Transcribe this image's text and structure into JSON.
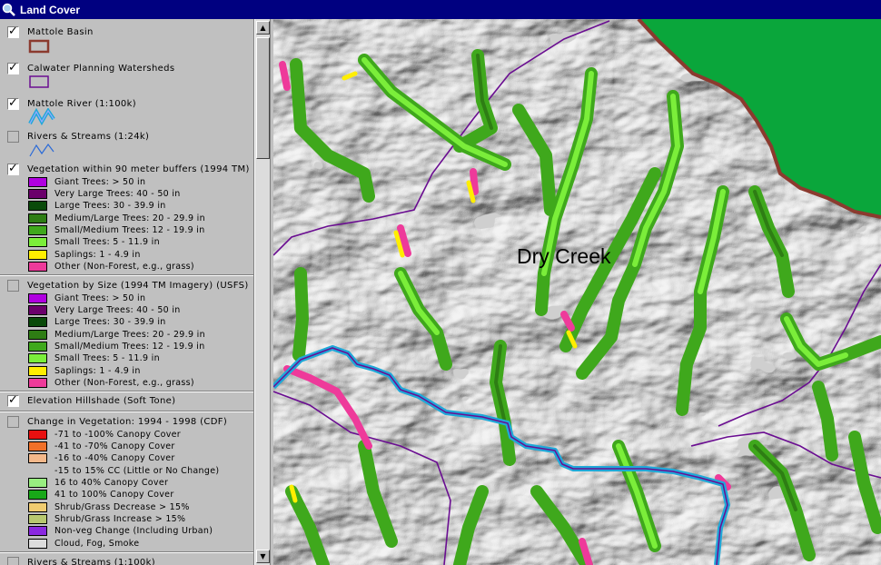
{
  "window": {
    "title": "Land Cover"
  },
  "colors": {
    "titlebar": "#000080",
    "basin_outline": "#8b3a2e",
    "watershed_outline": "#6a0d91",
    "river": "#1fa8d8",
    "forest_fill": "#0aa63b"
  },
  "themes": [
    {
      "id": "basin",
      "label": "Mattole Basin",
      "checked": true,
      "symbol": "basin-swatch"
    },
    {
      "id": "watersheds",
      "label": "Calwater Planning Watersheds",
      "checked": true,
      "symbol": "watershed-swatch"
    },
    {
      "id": "river100k",
      "label": "Mattole River (1:100k)",
      "checked": true,
      "symbol": "river-icon"
    },
    {
      "id": "streams24k",
      "label": "Rivers & Streams (1:24k)",
      "checked": false,
      "symbol": "stream-icon"
    },
    {
      "id": "veg90",
      "label": "Vegetation within 90 meter buffers (1994 TM)",
      "checked": true,
      "classes": [
        {
          "label": "Giant Trees: > 50 in",
          "color": "#b000e0"
        },
        {
          "label": "Very Large Trees: 40 - 50 in",
          "color": "#6b006b"
        },
        {
          "label": "Large Trees: 30 - 39.9 in",
          "color": "#0a4a0a"
        },
        {
          "label": "Medium/Large Trees: 20 - 29.9 in",
          "color": "#2e7d14"
        },
        {
          "label": "Small/Medium Trees: 12 - 19.9 in",
          "color": "#3fa81c"
        },
        {
          "label": "Small Trees: 5 - 11.9 in",
          "color": "#7bee3a"
        },
        {
          "label": "Saplings: 1 - 4.9 in",
          "color": "#ffee00"
        },
        {
          "label": "Other (Non-Forest, e.g., grass)",
          "color": "#ee3a9a"
        }
      ]
    },
    {
      "id": "vegsize",
      "label": "Vegetation by Size (1994 TM Imagery) (USFS)",
      "checked": false,
      "classes": [
        {
          "label": "Giant Trees: > 50 in",
          "color": "#b000e0"
        },
        {
          "label": "Very Large Trees: 40 - 50 in",
          "color": "#6b006b"
        },
        {
          "label": "Large Trees: 30 - 39.9 in",
          "color": "#0a4a0a"
        },
        {
          "label": "Medium/Large Trees: 20 - 29.9 in",
          "color": "#2e7d14"
        },
        {
          "label": "Small/Medium Trees: 12 - 19.9 in",
          "color": "#3fa81c"
        },
        {
          "label": "Small Trees: 5 - 11.9 in",
          "color": "#7bee3a"
        },
        {
          "label": "Saplings: 1 - 4.9 in",
          "color": "#ffee00"
        },
        {
          "label": "Other (Non-Forest, e.g., grass)",
          "color": "#ee3a9a"
        }
      ]
    },
    {
      "id": "hillshade",
      "label": "Elevation Hillshade (Soft Tone)",
      "checked": true
    },
    {
      "id": "change",
      "label": "Change in Vegetation: 1994 - 1998 (CDF)",
      "checked": false,
      "classes": [
        {
          "label": "-71 to -100% Canopy Cover",
          "color": "#e81010"
        },
        {
          "label": "-41 to -70% Canopy Cover",
          "color": "#f07028"
        },
        {
          "label": "-16 to -40% Canopy Cover",
          "color": "#f4b88a"
        },
        {
          "label": "-15 to 15% CC (Little or No Change)",
          "color": "#c0c0c0"
        },
        {
          "label": "16 to 40% Canopy Cover",
          "color": "#98ee80"
        },
        {
          "label": "41 to 100% Canopy Cover",
          "color": "#18a818"
        },
        {
          "label": "Shrub/Grass Decrease > 15%",
          "color": "#f0cc70"
        },
        {
          "label": "Shrub/Grass Increase > 15%",
          "color": "#b8c870"
        },
        {
          "label": "Non-veg Change (Including Urban)",
          "color": "#8a28e0"
        },
        {
          "label": "Cloud, Fog, Smoke",
          "color": "#dcdcdc"
        }
      ]
    },
    {
      "id": "streams100k",
      "label": "Rivers & Streams (1:100k)",
      "checked": false
    }
  ],
  "map": {
    "place_label": "Dry Creek"
  }
}
